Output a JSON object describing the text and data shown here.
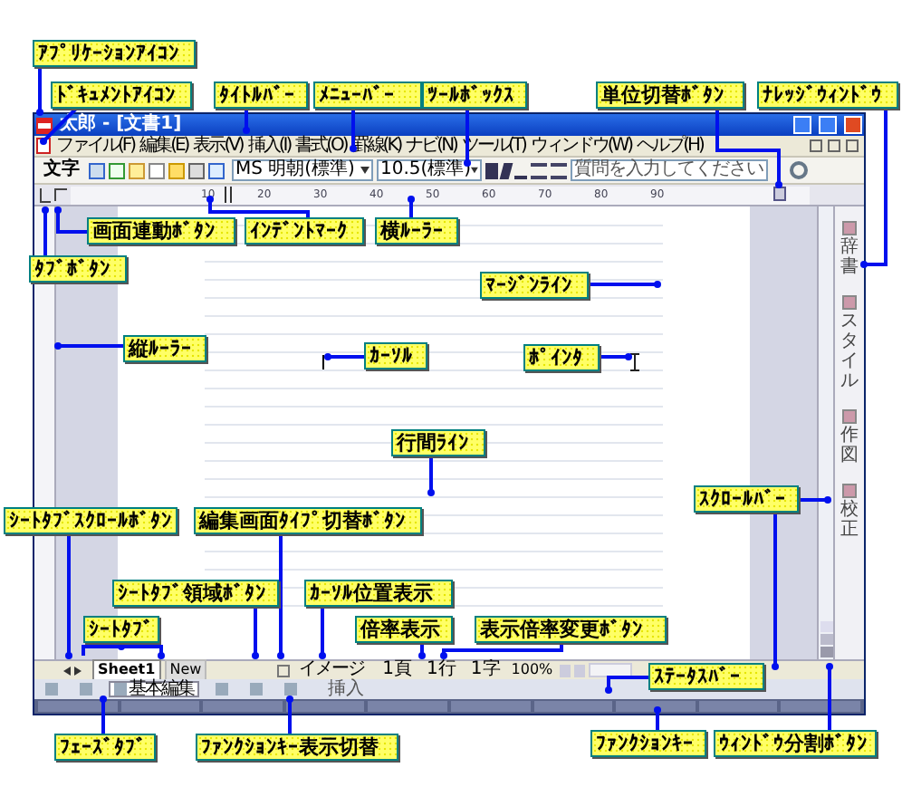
{
  "window": {
    "title": "太郎 - [文書1]"
  },
  "menu": [
    "ファイル(F)",
    "編集(E)",
    "表示(V)",
    "挿入(I)",
    "書式(O)",
    "罫線(K)",
    "ナビ(N)",
    "ツール(T)",
    "ウィンドウ(W)",
    "ヘルプ(H)"
  ],
  "toolbar": {
    "label": "文字",
    "font": "MS 明朝(標準)",
    "size": "10.5(標準)",
    "question": {
      "placeholder": "質問を入力してください"
    }
  },
  "ruler": {
    "ticks": [
      "10",
      "20",
      "30",
      "40",
      "50",
      "60",
      "70",
      "80",
      "90"
    ]
  },
  "task_pane": [
    "辞書",
    "スタイル",
    "作図",
    "校正"
  ],
  "sheet_tabs": [
    {
      "label": "Sheet1",
      "selected": true
    },
    {
      "label": "New",
      "selected": false
    }
  ],
  "status_bar": {
    "edit_type": "イメージ",
    "page": "1頁",
    "line": "1行",
    "column": "1字",
    "zoom": "100%"
  },
  "phase_tabs": [
    {
      "selected": false
    },
    {
      "selected": false
    },
    {
      "label": "基本編集",
      "selected": true
    },
    {
      "selected": false
    },
    {
      "selected": false
    },
    {
      "selected": false
    }
  ],
  "function_key_toggle": "挿入",
  "callouts": [
    "ｱﾌﾟﾘｹｰｼｮﾝｱｲｺﾝ",
    "ﾄﾞｷｭﾒﾝﾄｱｲｺﾝ",
    "ﾀｲﾄﾙﾊﾞｰ",
    "ﾒﾆｭｰﾊﾞｰ",
    "ﾂｰﾙﾎﾞｯｸｽ",
    "単位切替ﾎﾞﾀﾝ",
    "ﾅﾚｯｼﾞｳｨﾝﾄﾞｳ",
    "画面連動ﾎﾞﾀﾝ",
    "ｲﾝﾃﾞﾝﾄﾏｰｸ",
    "横ﾙｰﾗｰ",
    "ﾀﾌﾞﾎﾞﾀﾝ",
    "ﾏｰｼﾞﾝﾗｲﾝ",
    "縦ﾙｰﾗｰ",
    "ｶｰｿﾙ",
    "ﾎﾟｲﾝﾀ",
    "行間ﾗｲﾝ",
    "ｽｸﾛｰﾙﾊﾞｰ",
    "ｼｰﾄﾀﾌﾞｽｸﾛｰﾙﾎﾞﾀﾝ",
    "編集画面ﾀｲﾌﾟ切替ﾎﾞﾀﾝ",
    "ｼｰﾄﾀﾌﾞ領域ﾎﾞﾀﾝ",
    "ｶｰｿﾙ位置表示",
    "ｼｰﾄﾀﾌﾞ",
    "倍率表示",
    "表示倍率変更ﾎﾞﾀﾝ",
    "ｽﾃｰﾀｽﾊﾞｰ",
    "ﾌｪｰｽﾞﾀﾌﾞ",
    "ﾌｧﾝｸｼｮﾝｷｰ表示切替",
    "ﾌｧﾝｸｼｮﾝｷｰ",
    "ｳｨﾝﾄﾞｳ分割ﾎﾞﾀﾝ"
  ]
}
